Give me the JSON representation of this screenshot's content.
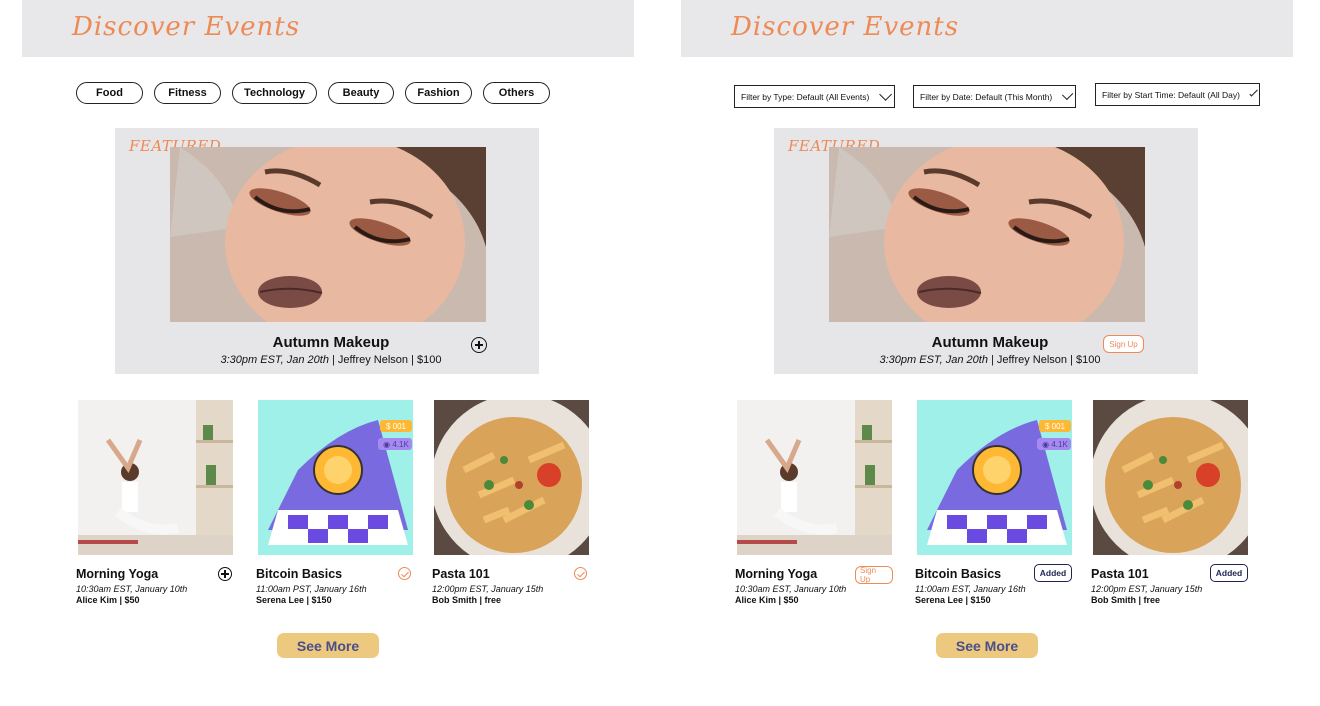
{
  "left": {
    "header_title": "Discover Events",
    "categories": [
      "Food",
      "Fitness",
      "Technology",
      "Beauty",
      "Fashion",
      "Others"
    ],
    "featured": {
      "tag": "FEATURED",
      "title": "Autumn Makeup",
      "time": "3:30pm EST, Jan 20th",
      "details": " | Jeffrey Nelson | $100"
    },
    "events": [
      {
        "title": "Morning Yoga",
        "time": "10:30am EST, January 10th",
        "host": "Alice Kim | $50"
      },
      {
        "title": "Bitcoin Basics",
        "time": "11:00am PST, January 16th",
        "host": "Serena Lee | $150"
      },
      {
        "title": "Pasta 101",
        "time": "12:00pm EST, January 15th",
        "host": "Bob Smith | free"
      }
    ],
    "see_more": "See More"
  },
  "right": {
    "header_title": "Discover Events",
    "filters": {
      "type": "Filter by Type:  Default (All Events)",
      "date": "Filter by Date:  Default (This Month)",
      "time": "Filter by Start Time:  Default (All Day)"
    },
    "featured": {
      "tag": "FEATURED",
      "title": "Autumn Makeup",
      "time": "3:30pm EST, Jan 20th",
      "details": " | Jeffrey Nelson | $100",
      "signup": "Sign Up"
    },
    "events": [
      {
        "title": "Morning Yoga",
        "time": "10:30am EST, January 10th",
        "host": "Alice Kim | $50",
        "action": "Sign Up"
      },
      {
        "title": "Bitcoin Basics",
        "time": "11:00am EST, January 16th",
        "host": "Serena Lee | $150",
        "action": "Added"
      },
      {
        "title": "Pasta 101",
        "time": "12:00pm EST, January 15th",
        "host": "Bob Smith | free",
        "action": "Added"
      }
    ],
    "see_more": "See More"
  },
  "badges": {
    "price": "$ 001",
    "views": "4.1K"
  },
  "colors": {
    "accent_orange": "#ee8a55",
    "header_bg": "#e8e8ea",
    "see_more_bg": "#ecc97e",
    "navy": "#1f2350"
  }
}
